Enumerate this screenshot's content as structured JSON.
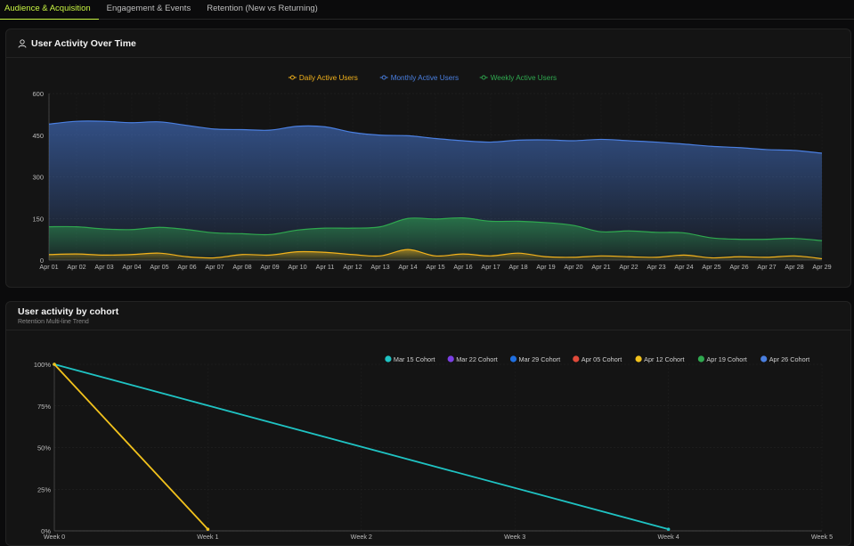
{
  "tabs": [
    {
      "label": "Audience & Acquisition",
      "active": true
    },
    {
      "label": "Engagement & Events",
      "active": false
    },
    {
      "label": "Retention (New vs Returning)",
      "active": false
    }
  ],
  "activity_card": {
    "title": "User Activity Over Time",
    "icon": "user-icon"
  },
  "cohort_card": {
    "title": "User activity by cohort",
    "subtitle": "Retention Multi-line Trend"
  },
  "chart_data": [
    {
      "type": "area",
      "ylim": [
        0,
        600
      ],
      "yticks": [
        "0",
        "150",
        "300",
        "450",
        "600"
      ],
      "categories": [
        "Apr 01",
        "Apr 02",
        "Apr 03",
        "Apr 04",
        "Apr 05",
        "Apr 06",
        "Apr 07",
        "Apr 08",
        "Apr 09",
        "Apr 10",
        "Apr 11",
        "Apr 12",
        "Apr 13",
        "Apr 14",
        "Apr 15",
        "Apr 16",
        "Apr 17",
        "Apr 18",
        "Apr 19",
        "Apr 20",
        "Apr 21",
        "Apr 22",
        "Apr 23",
        "Apr 24",
        "Apr 25",
        "Apr 26",
        "Apr 27",
        "Apr 28",
        "Apr 29"
      ],
      "legend_position": "top-center",
      "series": [
        {
          "name": "Daily Active Users",
          "color": "#f2b21c",
          "values": [
            20,
            22,
            18,
            20,
            25,
            12,
            8,
            20,
            18,
            30,
            28,
            20,
            15,
            38,
            15,
            22,
            15,
            25,
            12,
            10,
            15,
            12,
            10,
            18,
            8,
            12,
            10,
            15,
            5
          ]
        },
        {
          "name": "Monthly Active Users",
          "color": "#4a7fe0",
          "values": [
            490,
            500,
            500,
            495,
            498,
            485,
            472,
            470,
            468,
            482,
            480,
            460,
            450,
            448,
            438,
            430,
            425,
            432,
            433,
            430,
            435,
            430,
            425,
            418,
            410,
            405,
            398,
            395,
            385
          ]
        },
        {
          "name": "Weekly Active Users",
          "color": "#2fa84f",
          "values": [
            120,
            120,
            112,
            110,
            118,
            110,
            98,
            95,
            92,
            108,
            115,
            115,
            120,
            150,
            148,
            152,
            140,
            140,
            135,
            125,
            102,
            105,
            100,
            98,
            80,
            75,
            75,
            78,
            70
          ]
        }
      ]
    },
    {
      "type": "line",
      "ylim": [
        0,
        100
      ],
      "yticks": [
        "0%",
        "25%",
        "50%",
        "75%",
        "100%"
      ],
      "categories": [
        "Week 0",
        "Week 1",
        "Week 2",
        "Week 3",
        "Week 4",
        "Week 5"
      ],
      "legend_position": "top-right",
      "legend": [
        {
          "name": "Mar 15 Cohort",
          "color": "#1fc3c3"
        },
        {
          "name": "Mar 22 Cohort",
          "color": "#7b3fe4"
        },
        {
          "name": "Mar 29 Cohort",
          "color": "#1f6fe0"
        },
        {
          "name": "Apr 05 Cohort",
          "color": "#e04a3a"
        },
        {
          "name": "Apr 12 Cohort",
          "color": "#f2c21c"
        },
        {
          "name": "Apr 19 Cohort",
          "color": "#2fa84f"
        },
        {
          "name": "Apr 26 Cohort",
          "color": "#4a7fe0"
        }
      ],
      "series": [
        {
          "name": "Mar 15 Cohort",
          "color": "#1fc3c3",
          "points": [
            [
              0,
              100
            ],
            [
              4,
              1
            ]
          ]
        },
        {
          "name": "Apr 12 Cohort",
          "color": "#f2c21c",
          "points": [
            [
              0,
              100
            ],
            [
              1,
              1
            ]
          ]
        }
      ]
    }
  ]
}
